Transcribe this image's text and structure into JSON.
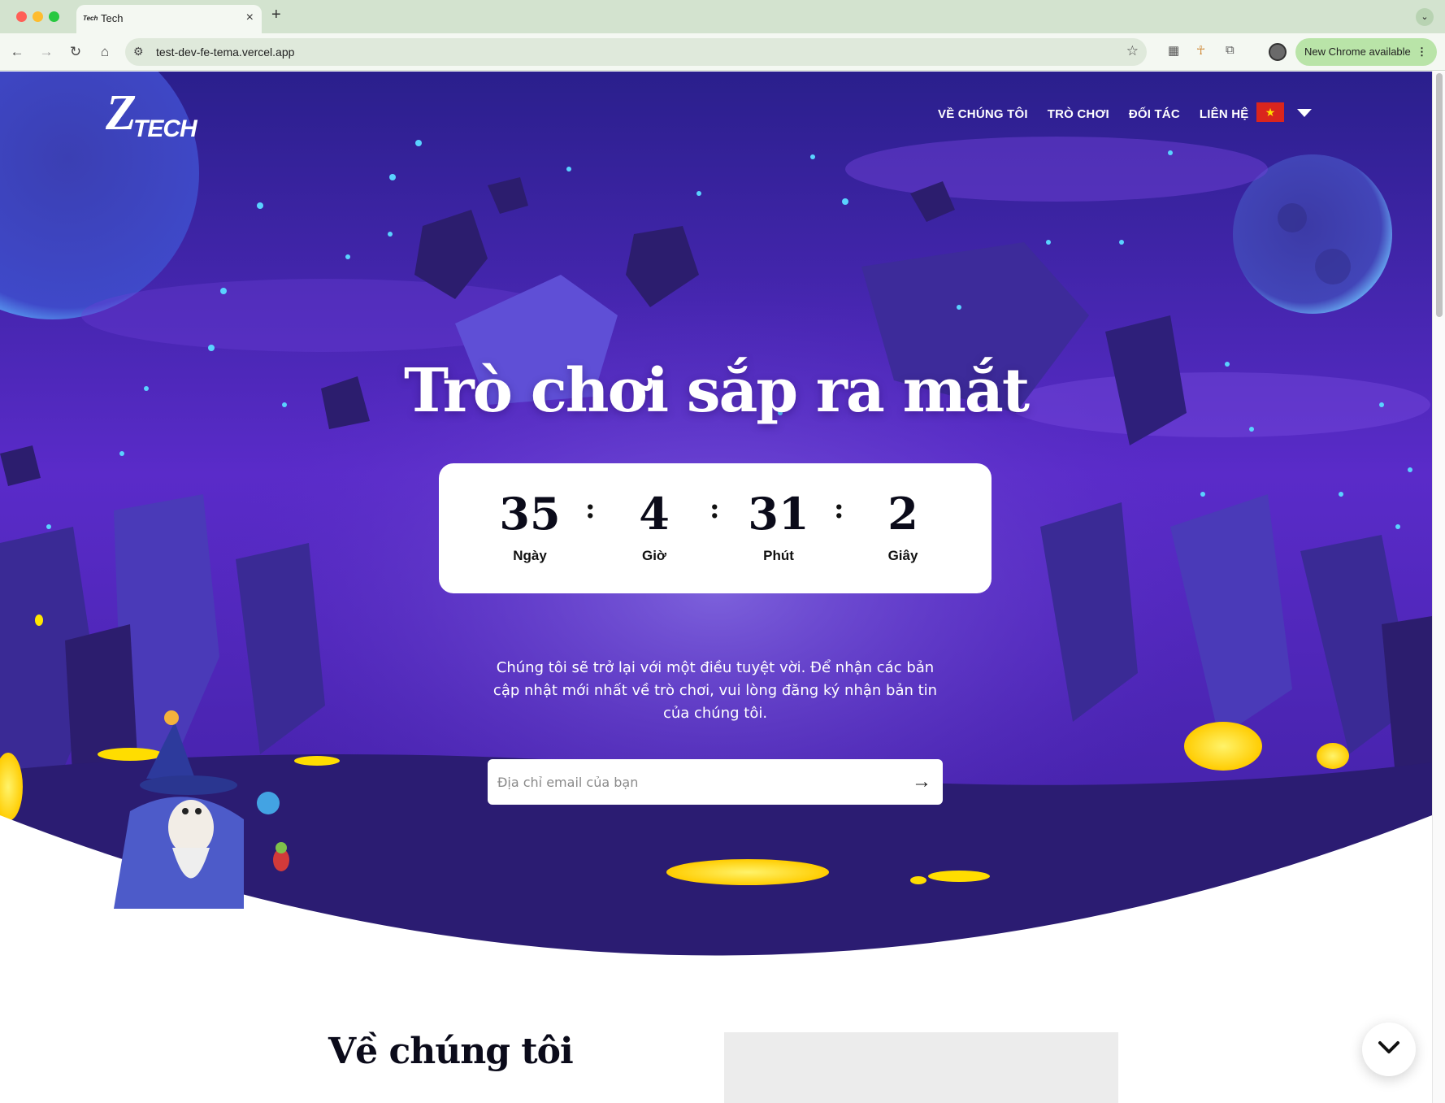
{
  "browser": {
    "tab_title": "Tech",
    "tab_favicon_text": "Tech",
    "url": "test-dev-fe-tema.vercel.app",
    "update_label": "New Chrome available",
    "icons": [
      "back-icon",
      "forward-icon",
      "reload-icon",
      "home-icon",
      "site-info-icon",
      "bookmark-star-icon",
      "extension-icon",
      "profile-avatar",
      "menu-dots-icon"
    ]
  },
  "header": {
    "logo_mark": "Z",
    "logo_text": "TECH",
    "nav": [
      "VỀ CHÚNG TÔI",
      "TRÒ CHƠI",
      "ĐỐI TÁC",
      "LIÊN HỆ"
    ],
    "language_flag_symbol": "★"
  },
  "hero": {
    "title": "Trò chơi sắp ra mắt",
    "countdown": {
      "days": "35",
      "days_label": "Ngày",
      "hours": "4",
      "hours_label": "Giờ",
      "minutes": "31",
      "minutes_label": "Phút",
      "seconds": "2",
      "seconds_label": "Giây",
      "separator": ":"
    },
    "description": "Chúng tôi sẽ trở lại với một điều tuyệt vời. Để nhận các bản cập nhật mới nhất về trò chơi, vui lòng đăng ký nhận bản tin của chúng tôi.",
    "email_placeholder": "Địa chỉ email của bạn",
    "submit_icon": "→"
  },
  "about": {
    "title": "Về chúng tôi"
  },
  "colors": {
    "sky_top": "#2a1f8c",
    "sky_mid": "#5a2bc9",
    "sky_bottom": "#3d1f9e",
    "glow_yellow": "#ffe600",
    "star_blue": "#5ad2ff",
    "chrome_green": "#d3e3cf",
    "update_green": "#b9e4a8"
  }
}
